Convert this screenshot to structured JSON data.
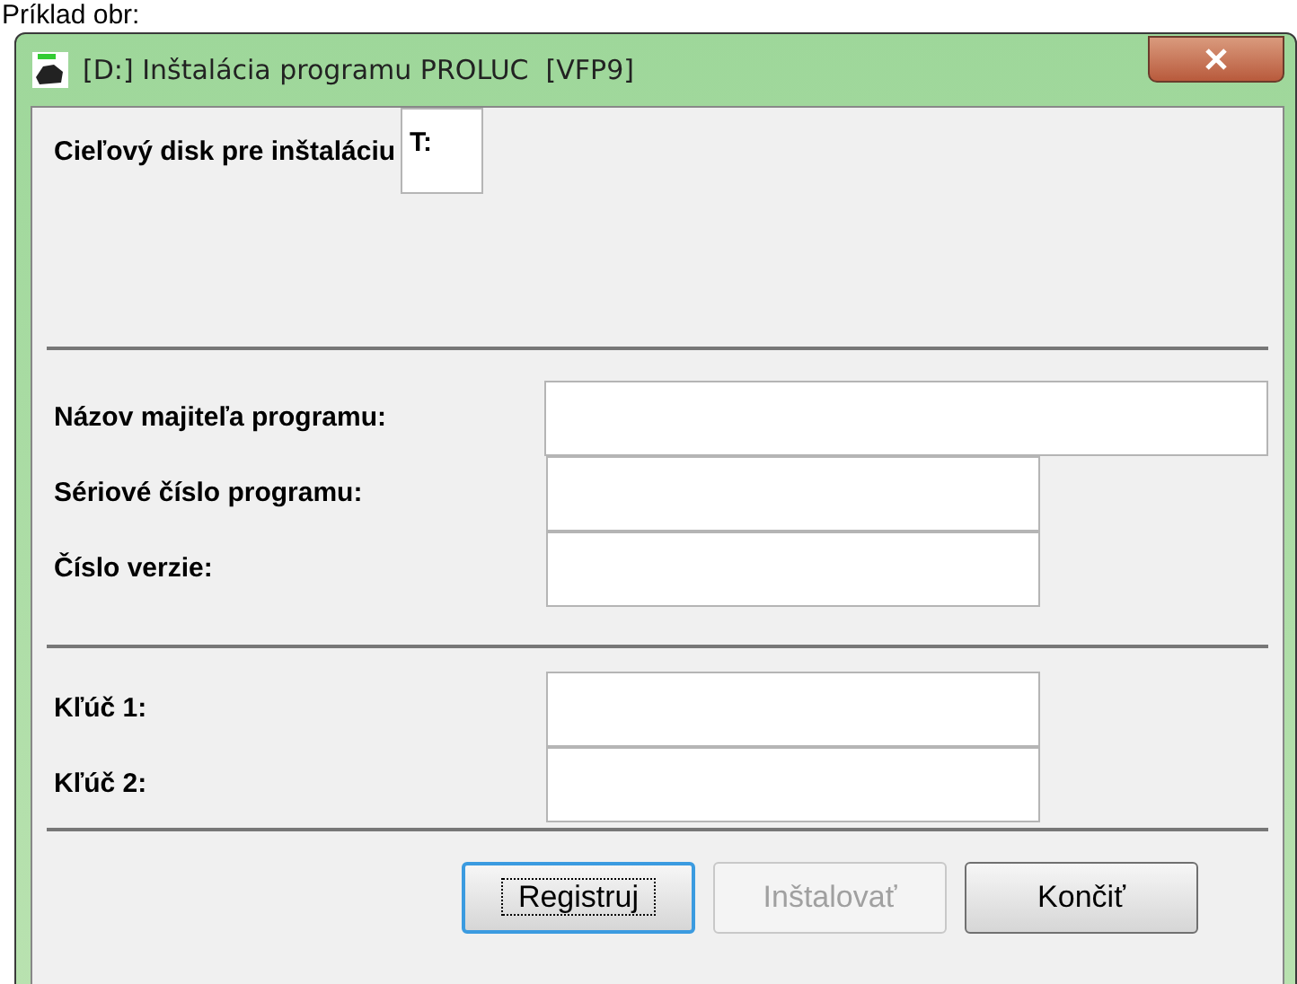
{
  "caption": "Príklad obr:",
  "window": {
    "title": "[D:] Inštalácia programu PROLUC  [VFP9]"
  },
  "disk": {
    "label": "Cieľový disk pre inštaláciu",
    "value": "T:"
  },
  "owner_fields": [
    {
      "label": "Názov majiteľa programu:",
      "kind": "wide"
    },
    {
      "label": "Sériové číslo programu:",
      "kind": "narrow"
    },
    {
      "label": "Číslo verzie:",
      "kind": "narrow"
    }
  ],
  "key_fields": [
    {
      "label": "Kľúč 1:"
    },
    {
      "label": "Kľúč 2:"
    }
  ],
  "buttons": [
    {
      "label": "Registruj",
      "focused": true,
      "disabled": false
    },
    {
      "label": "Inštalovať",
      "focused": false,
      "disabled": true
    },
    {
      "label": "Končiť",
      "focused": false,
      "disabled": false
    }
  ]
}
